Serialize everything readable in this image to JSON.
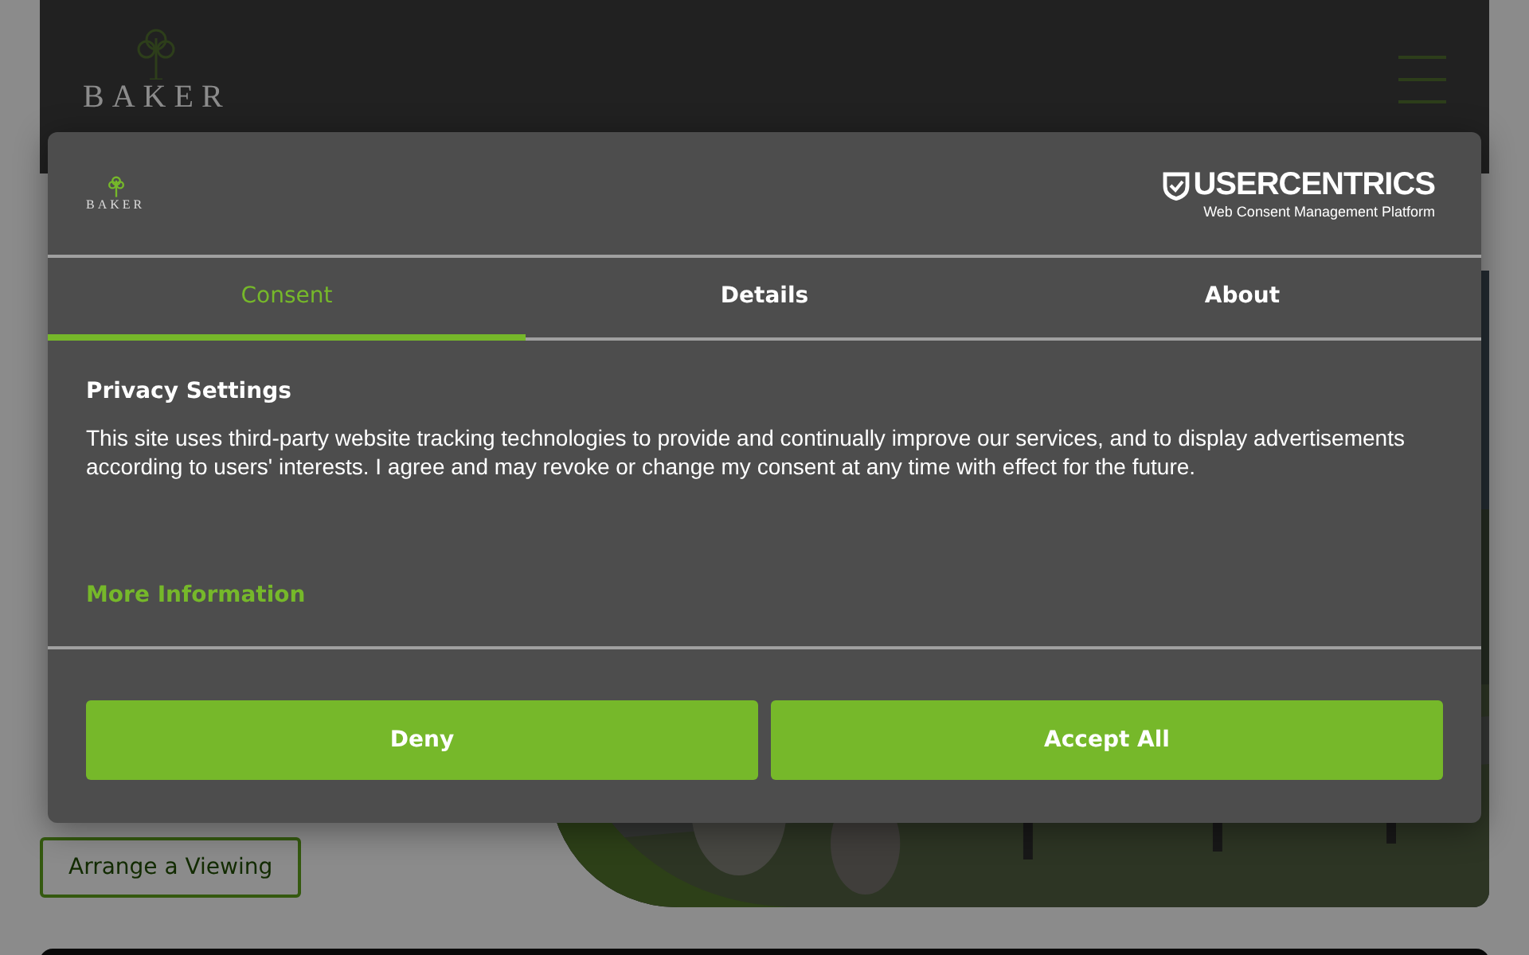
{
  "page": {
    "logo": "BAKER",
    "button": "Arrange a Viewing"
  },
  "dialog": {
    "logo": "BAKER",
    "brand": "USERCENTRICS",
    "brand_tagline": "Web Consent Management Platform",
    "tabs": [
      {
        "label": "Consent",
        "selected": true
      },
      {
        "label": "Details",
        "selected": false
      },
      {
        "label": "About",
        "selected": false
      }
    ],
    "heading": "Privacy Settings",
    "body": "This site uses third-party website tracking technologies to provide and continually improve our services, and to display advertisements according to users' interests. I agree and may revoke or change my consent at any time with effect for the future.",
    "link": "More Information",
    "buttons": [
      "Deny",
      "Accept All"
    ]
  }
}
